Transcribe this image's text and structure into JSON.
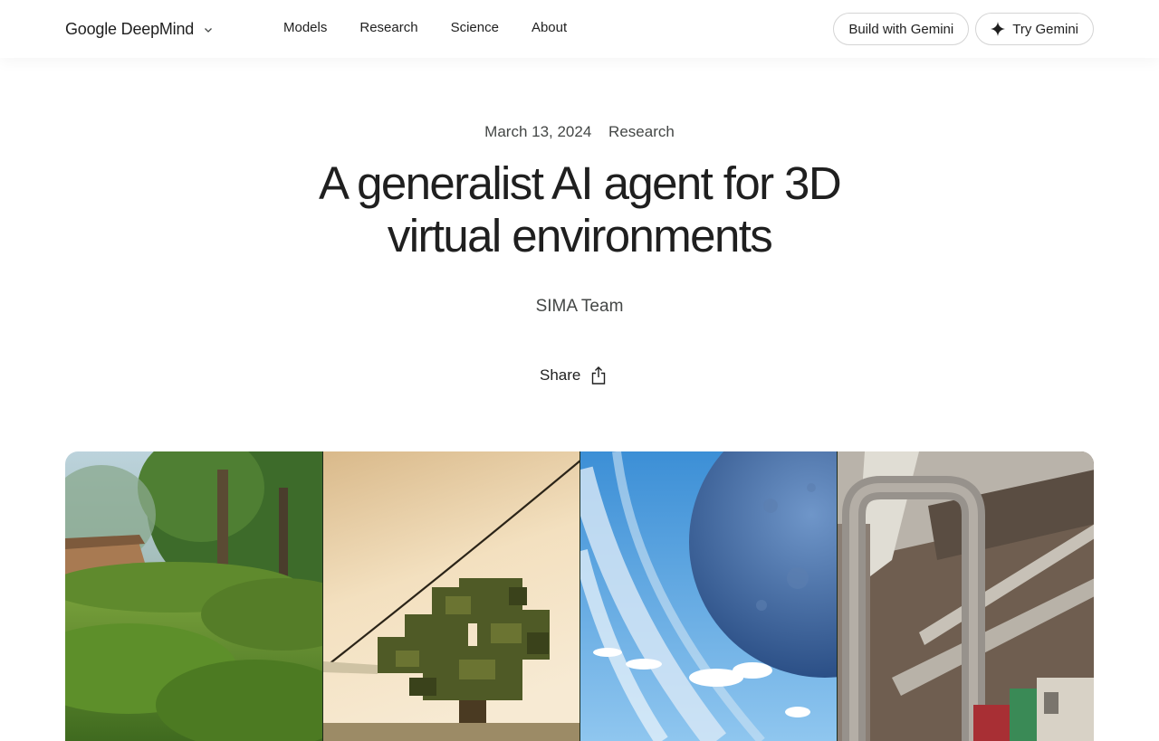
{
  "header": {
    "logo_text": "Google DeepMind",
    "nav": [
      {
        "label": "Models"
      },
      {
        "label": "Research"
      },
      {
        "label": "Science"
      },
      {
        "label": "About"
      }
    ],
    "build_button": "Build with Gemini",
    "try_button": "Try Gemini",
    "icons": {
      "logo_dropdown": "chevron-down-icon",
      "try_button": "sparkle-icon"
    }
  },
  "article": {
    "date": "March 13, 2024",
    "category": "Research",
    "title": "A generalist AI agent for 3D virtual environments",
    "author": "SIMA Team",
    "share_label": "Share",
    "share_icon": "share-icon"
  },
  "media": {
    "panels": [
      {
        "scene": "forest-game-scene"
      },
      {
        "scene": "blocky-sunset-scene"
      },
      {
        "scene": "planet-sky-scene"
      },
      {
        "scene": "warehouse-interior-scene"
      }
    ]
  },
  "colors": {
    "text_primary": "#1f1f1f",
    "text_secondary": "#444746",
    "pill_border": "#d4d4d4"
  }
}
